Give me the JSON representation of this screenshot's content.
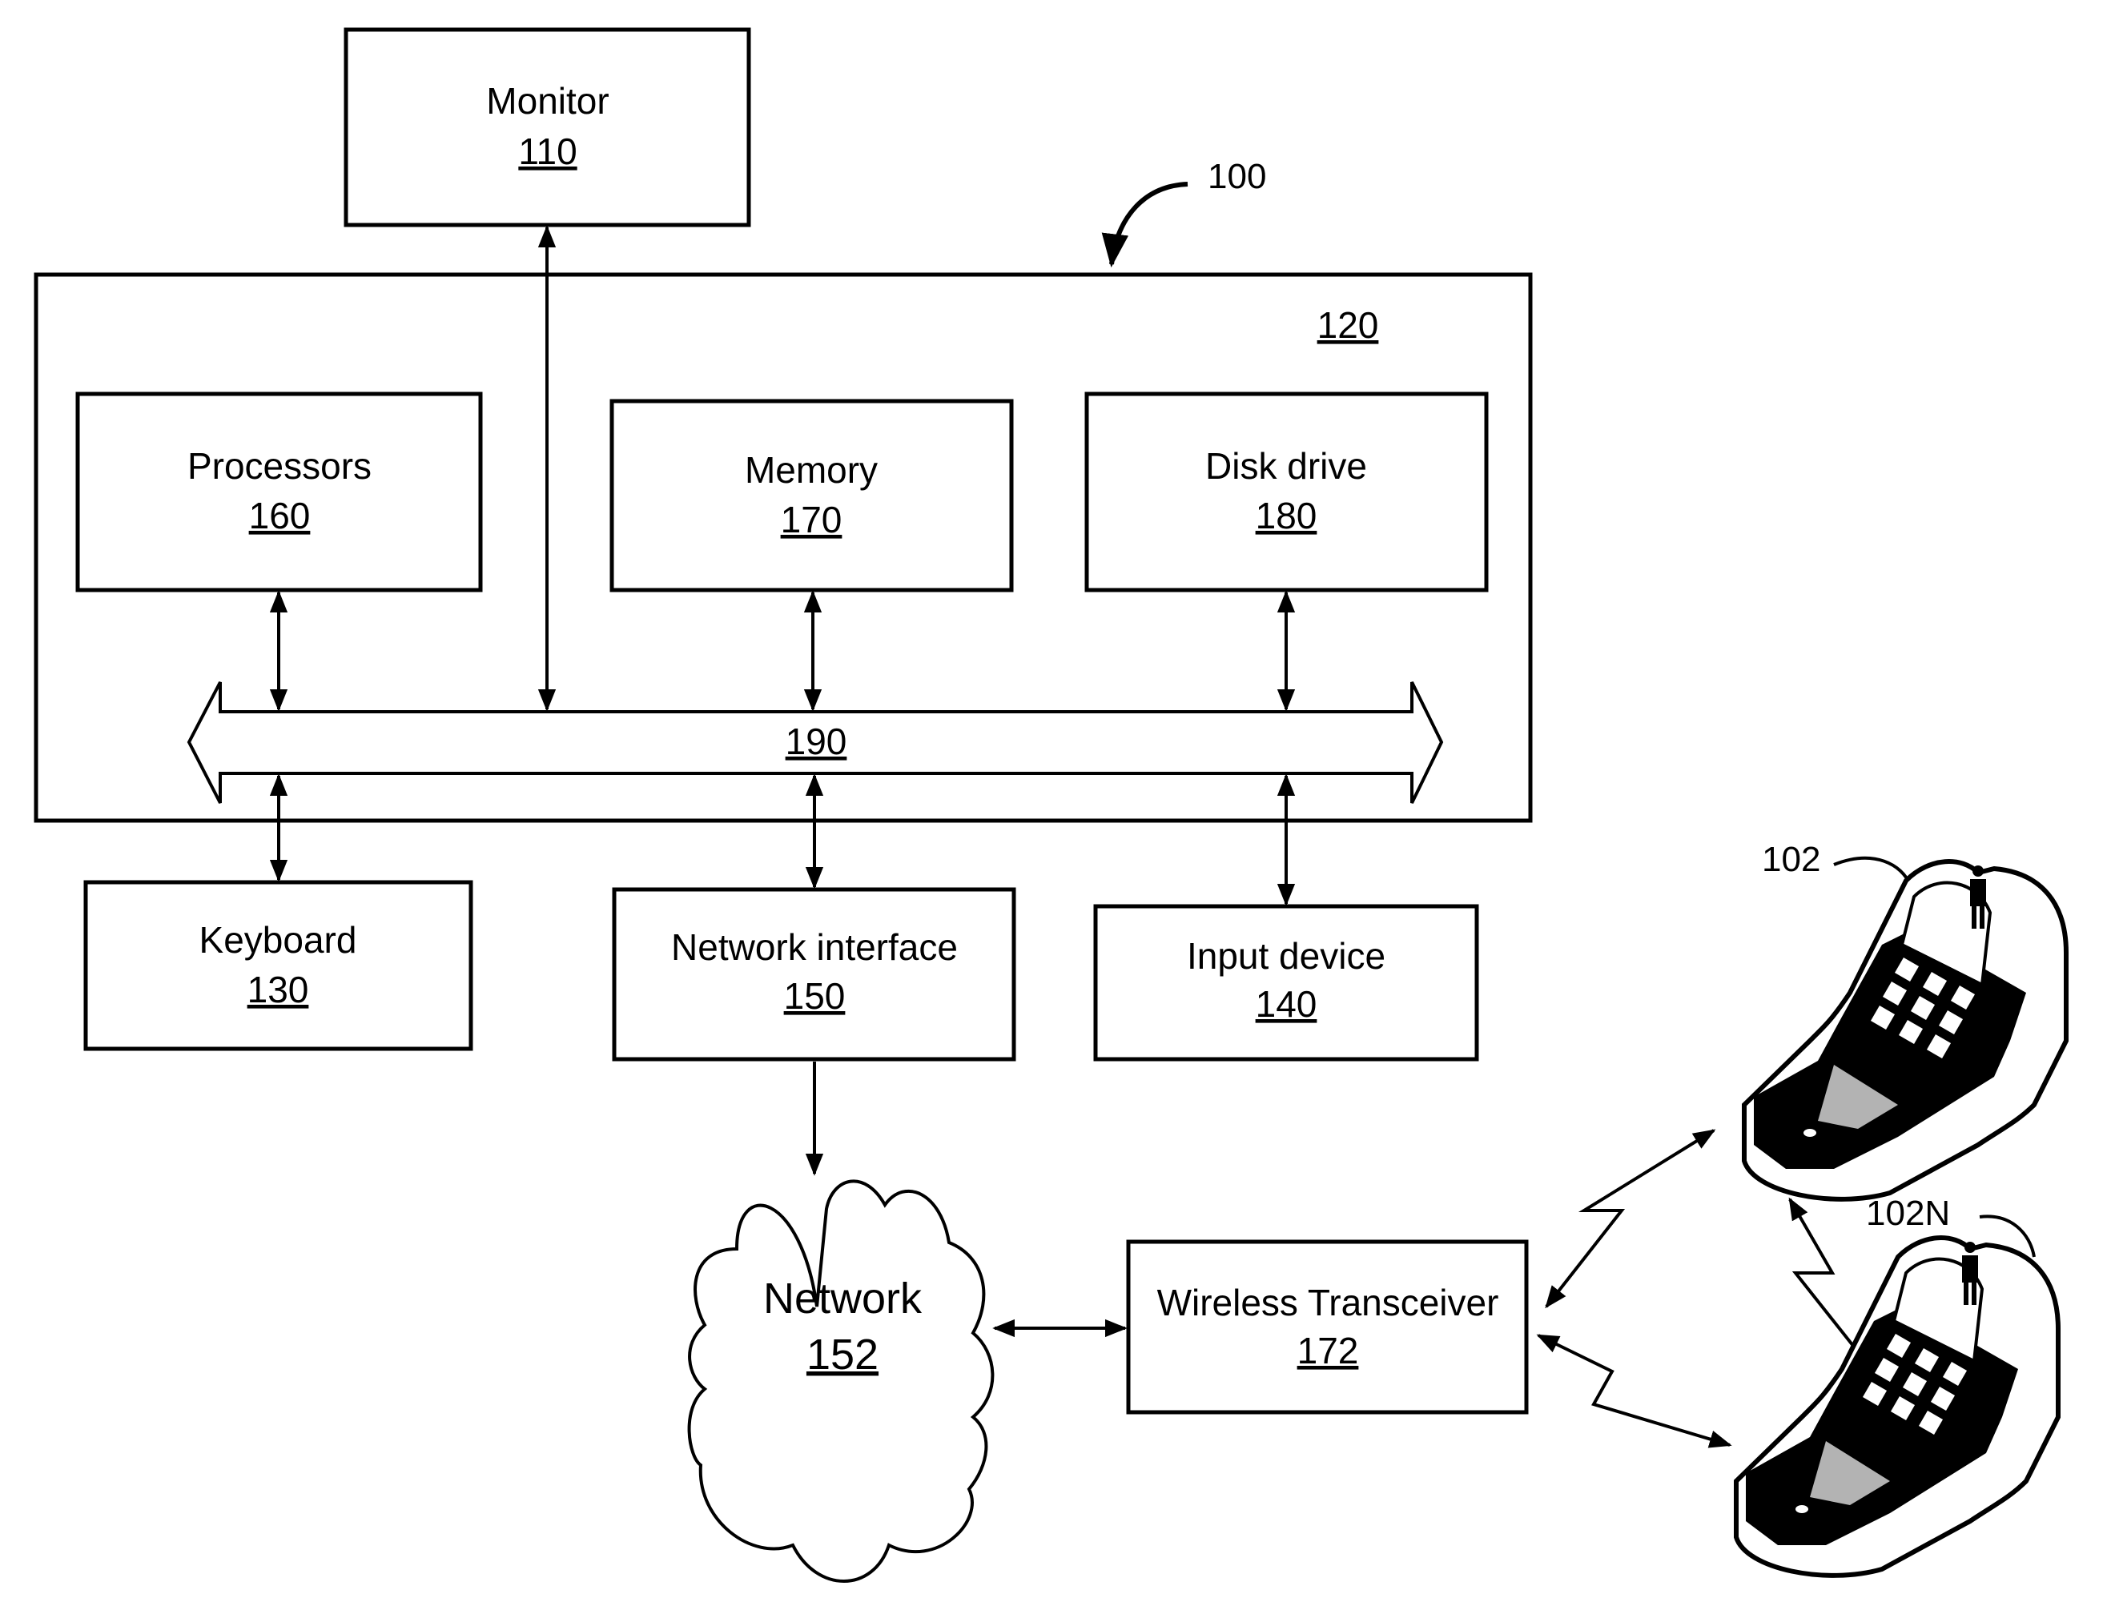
{
  "figure": {
    "reference": "100",
    "system_box": {
      "number": "120"
    },
    "bus": {
      "number": "190"
    },
    "components": {
      "monitor": {
        "label": "Monitor",
        "number": "110"
      },
      "processors": {
        "label": "Processors",
        "number": "160"
      },
      "memory": {
        "label": "Memory",
        "number": "170"
      },
      "disk_drive": {
        "label": "Disk drive",
        "number": "180"
      },
      "keyboard": {
        "label": "Keyboard",
        "number": "130"
      },
      "network_interface": {
        "label": "Network interface",
        "number": "150"
      },
      "input_device": {
        "label": "Input device",
        "number": "140"
      },
      "network": {
        "label": "Network",
        "number": "152"
      },
      "wireless_transceiver": {
        "label": "Wireless Transceiver",
        "number": "172"
      }
    },
    "devices": [
      {
        "reference": "102",
        "icon": "mobile-phone-icon"
      },
      {
        "reference": "102N",
        "icon": "mobile-phone-icon"
      }
    ]
  }
}
